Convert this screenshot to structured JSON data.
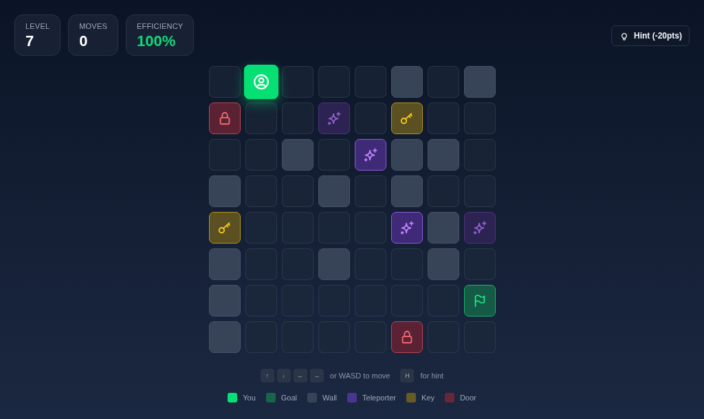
{
  "stats": [
    {
      "label": "LEVEL",
      "value": "7",
      "kind": "plain"
    },
    {
      "label": "MOVES",
      "value": "0",
      "kind": "plain"
    },
    {
      "label": "EFFICIENCY",
      "value": "100%",
      "kind": "highlight"
    }
  ],
  "hint_button": {
    "label": "Hint (-20pts)"
  },
  "grid": {
    "rows": [
      [
        {
          "kind": "floor"
        },
        {
          "kind": "player"
        },
        {
          "kind": "floor"
        },
        {
          "kind": "floor"
        },
        {
          "kind": "floor"
        },
        {
          "kind": "wall"
        },
        {
          "kind": "floor"
        },
        {
          "kind": "wall"
        }
      ],
      [
        {
          "kind": "door"
        },
        {
          "kind": "floor"
        },
        {
          "kind": "floor"
        },
        {
          "kind": "teleporter",
          "active": false
        },
        {
          "kind": "floor"
        },
        {
          "kind": "key"
        },
        {
          "kind": "floor"
        },
        {
          "kind": "floor"
        }
      ],
      [
        {
          "kind": "floor"
        },
        {
          "kind": "floor"
        },
        {
          "kind": "wall"
        },
        {
          "kind": "floor"
        },
        {
          "kind": "teleporter",
          "active": true
        },
        {
          "kind": "wall"
        },
        {
          "kind": "wall"
        },
        {
          "kind": "floor"
        }
      ],
      [
        {
          "kind": "wall"
        },
        {
          "kind": "floor"
        },
        {
          "kind": "floor"
        },
        {
          "kind": "wall"
        },
        {
          "kind": "floor"
        },
        {
          "kind": "wall"
        },
        {
          "kind": "floor"
        },
        {
          "kind": "floor"
        }
      ],
      [
        {
          "kind": "key"
        },
        {
          "kind": "floor"
        },
        {
          "kind": "floor"
        },
        {
          "kind": "floor"
        },
        {
          "kind": "floor"
        },
        {
          "kind": "teleporter",
          "active": true
        },
        {
          "kind": "wall"
        },
        {
          "kind": "teleporter",
          "active": false
        }
      ],
      [
        {
          "kind": "wall"
        },
        {
          "kind": "floor"
        },
        {
          "kind": "floor"
        },
        {
          "kind": "wall"
        },
        {
          "kind": "floor"
        },
        {
          "kind": "floor"
        },
        {
          "kind": "wall"
        },
        {
          "kind": "floor"
        }
      ],
      [
        {
          "kind": "wall"
        },
        {
          "kind": "floor"
        },
        {
          "kind": "floor"
        },
        {
          "kind": "floor"
        },
        {
          "kind": "floor"
        },
        {
          "kind": "floor"
        },
        {
          "kind": "floor"
        },
        {
          "kind": "goal"
        }
      ],
      [
        {
          "kind": "wall"
        },
        {
          "kind": "floor"
        },
        {
          "kind": "floor"
        },
        {
          "kind": "floor"
        },
        {
          "kind": "floor"
        },
        {
          "kind": "door"
        },
        {
          "kind": "floor"
        },
        {
          "kind": "floor"
        }
      ]
    ]
  },
  "controls_help": {
    "keys": [
      "↑",
      "↓",
      "←",
      "→"
    ],
    "move_text": "or WASD to move",
    "hint_key": "H",
    "hint_text": "for hint"
  },
  "legend": [
    {
      "label": "You",
      "color": "#05df73"
    },
    {
      "label": "Goal",
      "color": "#17654b"
    },
    {
      "label": "Wall",
      "color": "#374357"
    },
    {
      "label": "Teleporter",
      "color": "#4a3590"
    },
    {
      "label": "Key",
      "color": "#665a25"
    },
    {
      "label": "Door",
      "color": "#6a2639"
    }
  ]
}
